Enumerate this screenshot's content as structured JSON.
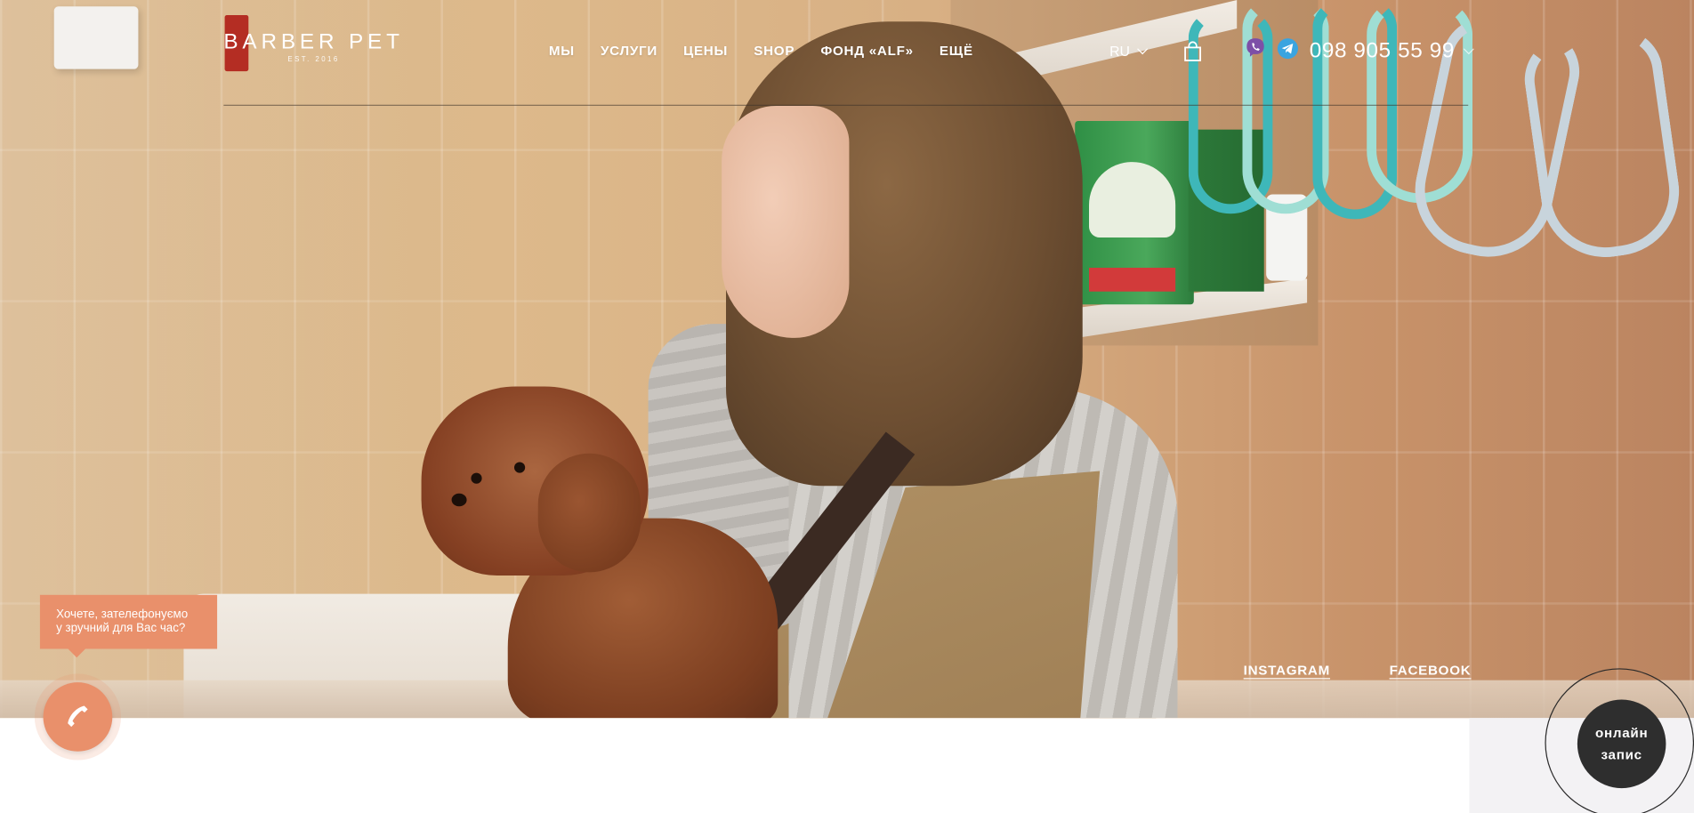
{
  "header": {
    "logo_text": "BARBER PET",
    "logo_sub": "EST. 2016",
    "nav": [
      {
        "label": "МЫ"
      },
      {
        "label": "УСЛУГИ"
      },
      {
        "label": "ЦЕНЫ"
      },
      {
        "label": "SHOP"
      },
      {
        "label": "ФОНД «ALF»"
      },
      {
        "label": "ЕЩЁ"
      }
    ],
    "language": "RU",
    "phone": "098 905 55 99"
  },
  "social": {
    "instagram": "INSTAGRAM",
    "facebook": "FACEBOOK"
  },
  "callback": {
    "line1": "Хочете, зателефонуємо",
    "line2": "у зручний для Вас час?"
  },
  "booking": {
    "line1": "онлайн",
    "line2": "запис"
  },
  "icons": {
    "cart": "shopping-bag-icon",
    "viber": "viber-icon",
    "telegram": "telegram-icon",
    "phone": "phone-icon"
  },
  "colors": {
    "accent": "#e9906b",
    "dark_button": "#2e2e2e",
    "viber": "#7d4fa7",
    "telegram": "#3aa4e0"
  }
}
